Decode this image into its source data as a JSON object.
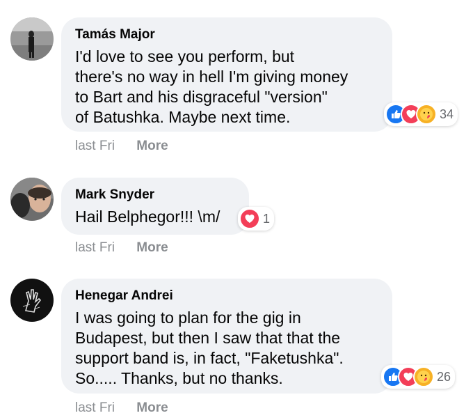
{
  "comments": [
    {
      "author": "Tamás Major",
      "text": "I'd love to see you perform, but\nthere's no way in hell I'm giving money\nto Bart and his disgraceful \"version\"\nof Batushka. Maybe next time.",
      "time": "last Fri",
      "more": "More",
      "reaction_count": "34",
      "reactions": [
        "like-icon",
        "love-icon",
        "care-icon"
      ]
    },
    {
      "author": "Mark Snyder",
      "text": "Hail Belphegor!!! \\m/",
      "time": "last Fri",
      "more": "More",
      "reaction_count": "1",
      "reactions": [
        "love-icon"
      ]
    },
    {
      "author": "Henegar Andrei",
      "text": "I was going to plan for the gig in\nBudapest, but then I saw that that the\nsupport band is, in fact, \"Faketushka\".\nSo..... Thanks, but no thanks.",
      "time": "last Fri",
      "more": "More",
      "reaction_count": "26",
      "reactions": [
        "like-icon",
        "love-icon",
        "care-icon"
      ]
    }
  ],
  "colors": {
    "bubble": "#f0f2f5",
    "text": "#050505",
    "meta": "#8a8d91",
    "like": "#1877f2",
    "love": "#f33e58",
    "care": "#f7b125"
  }
}
